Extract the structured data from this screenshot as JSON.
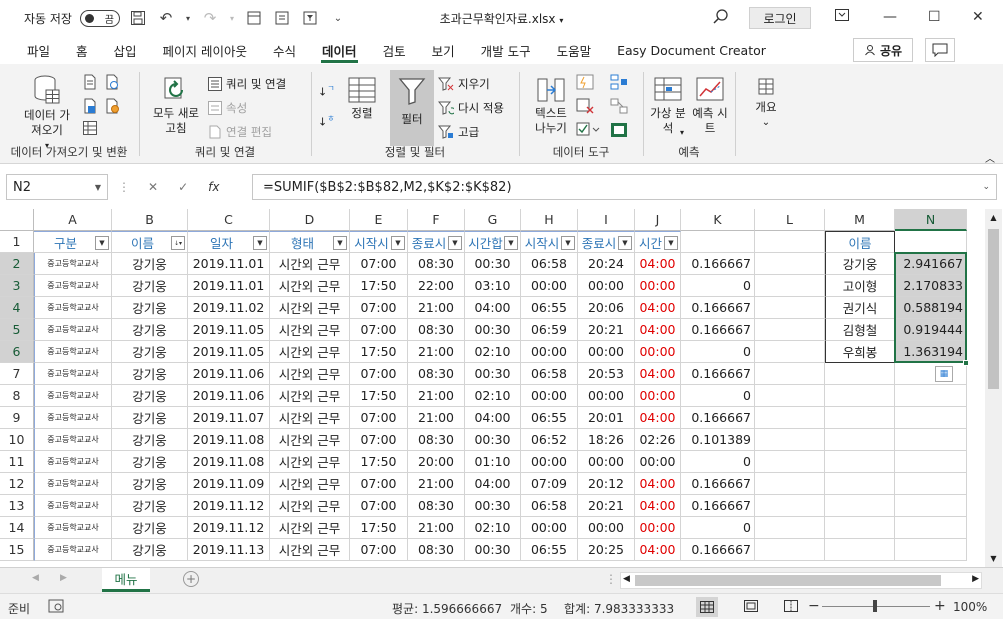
{
  "titlebar": {
    "autosave_label": "자동 저장",
    "autosave_state": "끔",
    "doc_title": "초과근무확인자료.xlsx",
    "login_label": "로그인"
  },
  "tabs": [
    "파일",
    "홈",
    "삽입",
    "페이지 레이아웃",
    "수식",
    "데이터",
    "검토",
    "보기",
    "개발 도구",
    "도움말",
    "Easy Document Creator"
  ],
  "active_tab": "데이터",
  "share_label": "공유",
  "ribbon": {
    "get_data": "데이터 가져오기",
    "group1_label": "데이터 가져오기 및 변환",
    "refresh_all": "모두 새로 고침",
    "queries_connections": "쿼리 및 연결",
    "properties": "속성",
    "edit_links": "연결 편집",
    "group2_label": "쿼리 및 연결",
    "sort": "정렬",
    "filter": "필터",
    "clear": "지우기",
    "reapply": "다시 적용",
    "advanced": "고급",
    "group3_label": "정렬 및 필터",
    "text_to_columns": "텍스트 나누기",
    "group4_label": "데이터 도구",
    "what_if": "가상 분석",
    "forecast_sheet": "예측 시트",
    "group5_label": "예측",
    "outline": "개요"
  },
  "formula_bar": {
    "name_box": "N2",
    "formula": "=SUMIF($B$2:$B$82,M2,$K$2:$K$82)"
  },
  "columns": [
    "A",
    "B",
    "C",
    "D",
    "E",
    "F",
    "G",
    "H",
    "I",
    "J",
    "K",
    "L",
    "M",
    "N"
  ],
  "header_row": [
    "구분",
    "이름",
    "일자",
    "형태",
    "시작시",
    "종료시",
    "시간합",
    "시작시",
    "종료시",
    "시간"
  ],
  "rows": [
    {
      "n": "1"
    },
    {
      "n": "2",
      "a": "중고등학교교사",
      "b": "강기웅",
      "c": "2019.11.01",
      "d": "시간외 근무",
      "e": "07:00",
      "f": "08:30",
      "g": "00:30",
      "h": "06:58",
      "i": "20:24",
      "j": "04:00",
      "k": "0.166667",
      "m": "강기웅",
      "nv": "2.941667"
    },
    {
      "n": "3",
      "a": "중고등학교교사",
      "b": "강기웅",
      "c": "2019.11.01",
      "d": "시간외 근무",
      "e": "17:50",
      "f": "22:00",
      "g": "03:10",
      "h": "00:00",
      "i": "00:00",
      "j": "00:00",
      "k": "0",
      "m": "고이형",
      "nv": "2.170833"
    },
    {
      "n": "4",
      "a": "중고등학교교사",
      "b": "강기웅",
      "c": "2019.11.02",
      "d": "시간외 근무",
      "e": "07:00",
      "f": "21:00",
      "g": "04:00",
      "h": "06:55",
      "i": "20:06",
      "j": "04:00",
      "k": "0.166667",
      "m": "권기식",
      "nv": "0.588194"
    },
    {
      "n": "5",
      "a": "중고등학교교사",
      "b": "강기웅",
      "c": "2019.11.05",
      "d": "시간외 근무",
      "e": "07:00",
      "f": "08:30",
      "g": "00:30",
      "h": "06:59",
      "i": "20:21",
      "j": "04:00",
      "k": "0.166667",
      "m": "김형철",
      "nv": "0.919444"
    },
    {
      "n": "6",
      "a": "중고등학교교사",
      "b": "강기웅",
      "c": "2019.11.05",
      "d": "시간외 근무",
      "e": "17:50",
      "f": "21:00",
      "g": "02:10",
      "h": "00:00",
      "i": "00:00",
      "j": "00:00",
      "k": "0",
      "m": "우희봉",
      "nv": "1.363194"
    },
    {
      "n": "7",
      "a": "중고등학교교사",
      "b": "강기웅",
      "c": "2019.11.06",
      "d": "시간외 근무",
      "e": "07:00",
      "f": "08:30",
      "g": "00:30",
      "h": "06:58",
      "i": "20:53",
      "j": "04:00",
      "k": "0.166667"
    },
    {
      "n": "8",
      "a": "중고등학교교사",
      "b": "강기웅",
      "c": "2019.11.06",
      "d": "시간외 근무",
      "e": "17:50",
      "f": "21:00",
      "g": "02:10",
      "h": "00:00",
      "i": "00:00",
      "j": "00:00",
      "k": "0"
    },
    {
      "n": "9",
      "a": "중고등학교교사",
      "b": "강기웅",
      "c": "2019.11.07",
      "d": "시간외 근무",
      "e": "07:00",
      "f": "21:00",
      "g": "04:00",
      "h": "06:55",
      "i": "20:01",
      "j": "04:00",
      "k": "0.166667"
    },
    {
      "n": "10",
      "a": "중고등학교교사",
      "b": "강기웅",
      "c": "2019.11.08",
      "d": "시간외 근무",
      "e": "07:00",
      "f": "08:30",
      "g": "00:30",
      "h": "06:52",
      "i": "18:26",
      "j": "02:26",
      "k": "0.101389"
    },
    {
      "n": "11",
      "a": "중고등학교교사",
      "b": "강기웅",
      "c": "2019.11.08",
      "d": "시간외 근무",
      "e": "17:50",
      "f": "20:00",
      "g": "01:10",
      "h": "00:00",
      "i": "00:00",
      "j": "00:00",
      "k": "0"
    },
    {
      "n": "12",
      "a": "중고등학교교사",
      "b": "강기웅",
      "c": "2019.11.09",
      "d": "시간외 근무",
      "e": "07:00",
      "f": "21:00",
      "g": "04:00",
      "h": "07:09",
      "i": "20:12",
      "j": "04:00",
      "k": "0.166667"
    },
    {
      "n": "13",
      "a": "중고등학교교사",
      "b": "강기웅",
      "c": "2019.11.12",
      "d": "시간외 근무",
      "e": "07:00",
      "f": "08:30",
      "g": "00:30",
      "h": "06:58",
      "i": "20:21",
      "j": "04:00",
      "k": "0.166667"
    },
    {
      "n": "14",
      "a": "중고등학교교사",
      "b": "강기웅",
      "c": "2019.11.12",
      "d": "시간외 근무",
      "e": "17:50",
      "f": "21:00",
      "g": "02:10",
      "h": "00:00",
      "i": "00:00",
      "j": "00:00",
      "k": "0"
    },
    {
      "n": "15",
      "a": "중고등학교교사",
      "b": "강기웅",
      "c": "2019.11.13",
      "d": "시간외 근무",
      "e": "07:00",
      "f": "08:30",
      "g": "00:30",
      "h": "06:55",
      "i": "20:25",
      "j": "04:00",
      "k": "0.166667"
    }
  ],
  "m_header": "이름",
  "sheet_tab": "메뉴",
  "status": {
    "ready": "준비",
    "average": "평균: 1.596666667",
    "count": "개수: 5",
    "sum": "합계: 7.983333333",
    "zoom": "100%"
  },
  "colors": {
    "accent": "#217346",
    "red": "#e00000",
    "header_text": "#2e75b6"
  }
}
